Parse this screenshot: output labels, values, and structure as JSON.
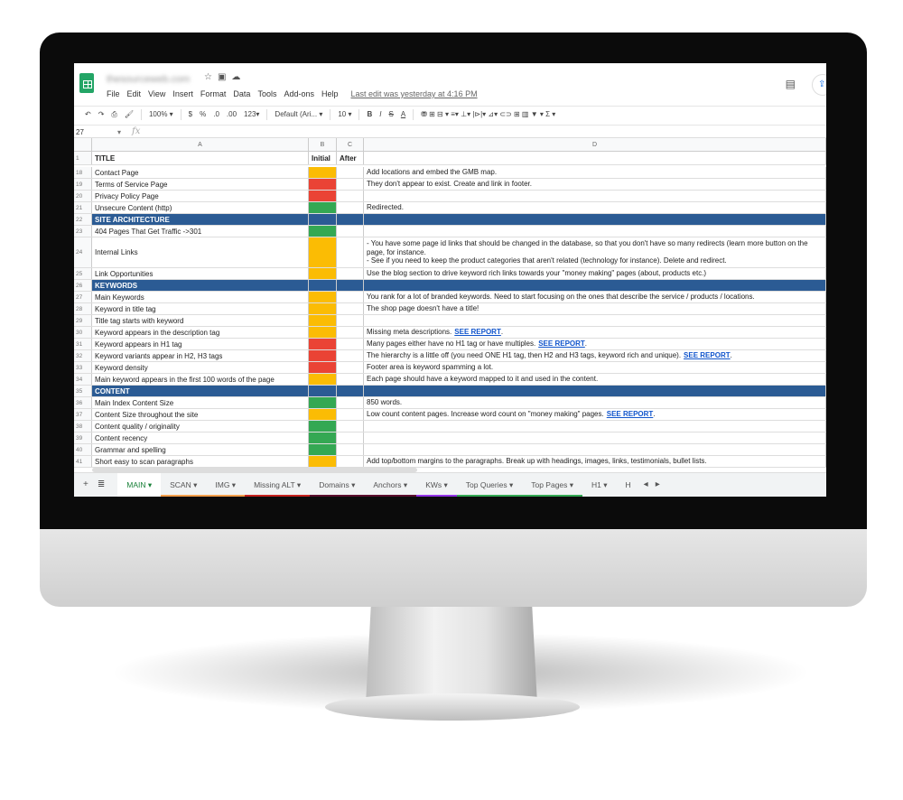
{
  "app": {
    "doc_title": "thesourceweb.com",
    "last_edit": "Last edit was yesterday at 4:16 PM"
  },
  "menu": [
    "File",
    "Edit",
    "View",
    "Insert",
    "Format",
    "Data",
    "Tools",
    "Add-ons",
    "Help"
  ],
  "toolbar": {
    "zoom": "100% ▾",
    "currency": "$",
    "percent": "%",
    "dec_less": ".0",
    "dec_more": ".00",
    "format": "123▾",
    "font": "Default (Ari... ▾",
    "size": "10 ▾",
    "bold": "B",
    "italic": "I",
    "strike": "S",
    "color": "A",
    "other": "⛃ ⊞ ⊟ ▾ ≡▾ ⊥▾ |⊳|▾ ⊿▾ ⊂⊃ ⊞ ▥ ▼ ▾ Σ ▾"
  },
  "formula_bar": {
    "cell_ref": "27",
    "fx": "fx"
  },
  "columns": [
    "A",
    "B",
    "C",
    "D"
  ],
  "status_colors": {
    "green": "#34a853",
    "yellow": "#fbbc04",
    "red": "#ea4335",
    "none": ""
  },
  "header_row": {
    "num": "1",
    "a": "TITLE",
    "b": "Initial",
    "c": "After"
  },
  "rows": [
    {
      "num": "18",
      "a": "Contact Page",
      "status": "yellow",
      "d": "Add locations and embed the GMB map."
    },
    {
      "num": "19",
      "a": "Terms of Service Page",
      "status": "red",
      "d": "They don't appear to exist. Create and link in footer."
    },
    {
      "num": "20",
      "a": "Privacy Policy Page",
      "status": "red",
      "d": ""
    },
    {
      "num": "21",
      "a": "Unsecure Content (http)",
      "status": "green",
      "d": "Redirected."
    },
    {
      "num": "22",
      "a": "SITE ARCHITECTURE",
      "section": true
    },
    {
      "num": "23",
      "a": "404 Pages That Get Traffic ->301",
      "status": "green",
      "d": ""
    },
    {
      "num": "24",
      "a": "Internal Links",
      "status": "yellow",
      "tall": true,
      "d": "- You have some page id links that should be changed in the database, so that you don't have so many redirects (learn more button on the\npage, for instance.\n- See if you need to keep the product categories that aren't related (technology for instance). Delete and redirect."
    },
    {
      "num": "25",
      "a": "Link Opportunities",
      "status": "yellow",
      "d": "Use the blog section to drive keyword rich links towards your \"money making\" pages (about, products etc.)"
    },
    {
      "num": "26",
      "a": "KEYWORDS",
      "section": true
    },
    {
      "num": "27",
      "a": "Main Keywords",
      "status": "yellow",
      "d": "You rank for a lot of branded keywords. Need to start focusing on the ones that describe the service / products / locations."
    },
    {
      "num": "28",
      "a": "Keyword in title tag",
      "status": "yellow",
      "d": "The shop page doesn't have a title!"
    },
    {
      "num": "29",
      "a": "Title tag starts with keyword",
      "status": "yellow",
      "d": ""
    },
    {
      "num": "30",
      "a": "Keyword appears in the description tag",
      "status": "yellow",
      "d": "Missing meta descriptions.",
      "link": "SEE REPORT"
    },
    {
      "num": "31",
      "a": "Keyword appears in H1 tag",
      "status": "red",
      "d": "Many pages either have no H1 tag or have multiples.",
      "link": "SEE REPORT"
    },
    {
      "num": "32",
      "a": "Keyword variants appear in H2, H3 tags",
      "status": "red",
      "d": "The hierarchy is a little off (you need ONE H1 tag, then H2 and H3 tags, keyword rich and unique).",
      "link": "SEE REPORT"
    },
    {
      "num": "33",
      "a": "Keyword density",
      "status": "red",
      "d": "Footer area is keyword spamming a lot."
    },
    {
      "num": "34",
      "a": "Main keyword appears in the first 100 words of the page",
      "status": "yellow",
      "d": "Each page should have a keyword mapped to it and used in the content."
    },
    {
      "num": "35",
      "a": "CONTENT",
      "section": true
    },
    {
      "num": "36",
      "a": "Main Index Content Size",
      "status": "green",
      "d": "850 words."
    },
    {
      "num": "37",
      "a": "Content Size throughout the site",
      "status": "yellow",
      "d": "Low count content pages. Increase word count on \"money making\" pages.",
      "link": "SEE REPORT"
    },
    {
      "num": "38",
      "a": "Content quality / originality",
      "status": "green",
      "d": ""
    },
    {
      "num": "39",
      "a": "Content recency",
      "status": "green",
      "d": ""
    },
    {
      "num": "40",
      "a": "Grammar and spelling",
      "status": "green",
      "d": ""
    },
    {
      "num": "41",
      "a": "Short easy to scan paragraphs",
      "status": "yellow",
      "d": "Add top/bottom margins to the paragraphs. Break up with headings, images, links, testimonials, bullet lists."
    }
  ],
  "sheet_tabs": [
    {
      "label": "MAIN ▾",
      "active": true,
      "color": ""
    },
    {
      "label": "SCAN ▾",
      "color": "#f6a04d"
    },
    {
      "label": "IMG ▾",
      "color": "#f6a04d"
    },
    {
      "label": "Missing ALT ▾",
      "color": "#c5221f"
    },
    {
      "label": "Domains ▾",
      "color": "#5b0f2e"
    },
    {
      "label": "Anchors ▾",
      "color": "#5b0f2e"
    },
    {
      "label": "KWs ▾",
      "color": "#9334e6"
    },
    {
      "label": "Top Queries ▾",
      "color": "#34a853"
    },
    {
      "label": "Top Pages ▾",
      "color": "#34a853"
    },
    {
      "label": "H1 ▾",
      "color": ""
    },
    {
      "label": "H",
      "color": ""
    }
  ],
  "tab_controls": {
    "add": "+",
    "list": "≣",
    "prev": "◂",
    "next": "▸"
  }
}
